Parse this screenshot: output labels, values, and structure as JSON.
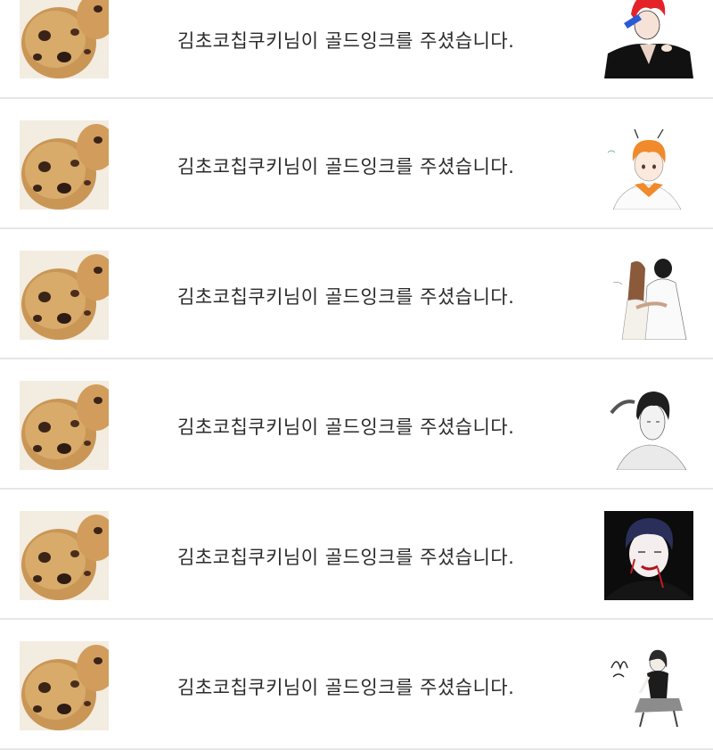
{
  "messages": [
    {
      "text": "김초코칩쿠키님이 골드잉크를 주셨습니다.",
      "sender_icon": "cookie-icon",
      "artwork_icon": "red-hair-man-artwork-icon"
    },
    {
      "text": "김초코칩쿠키님이 골드잉크를 주셨습니다.",
      "sender_icon": "cookie-icon",
      "artwork_icon": "orange-hair-boy-artwork-icon"
    },
    {
      "text": "김초코칩쿠키님이 골드잉크를 주셨습니다.",
      "sender_icon": "cookie-icon",
      "artwork_icon": "hugging-couple-artwork-icon"
    },
    {
      "text": "김초코칩쿠키님이 골드잉크를 주셨습니다.",
      "sender_icon": "cookie-icon",
      "artwork_icon": "sketch-man-artwork-icon"
    },
    {
      "text": "김초코칩쿠키님이 골드잉크를 주셨습니다.",
      "sender_icon": "cookie-icon",
      "artwork_icon": "bloody-man-artwork-icon"
    },
    {
      "text": "김초코칩쿠키님이 골드잉크를 주셨습니다.",
      "sender_icon": "cookie-icon",
      "artwork_icon": "sitting-woman-artwork-icon"
    }
  ],
  "colors": {
    "divider": "#e6e6e6",
    "text": "#2a2a2a",
    "background": "#ffffff"
  }
}
